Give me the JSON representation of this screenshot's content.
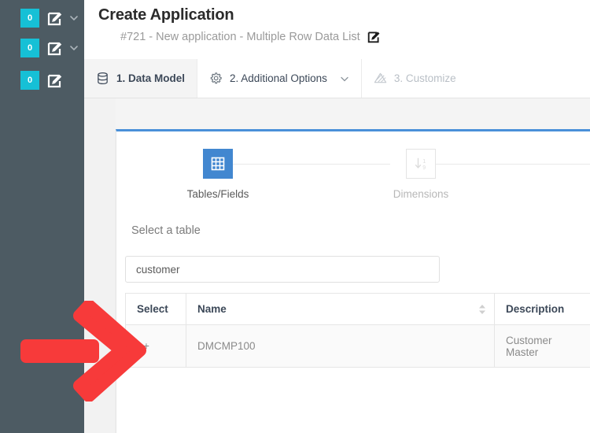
{
  "colors": {
    "sidebar_bg": "#4d5b63",
    "badge_bg": "#16c0d6",
    "accent_blue": "#4a90d9",
    "step_active": "#4287d0",
    "annotation_red": "#f73a3a",
    "panel_bg": "#ffffff",
    "page_bg": "#f2f2f2"
  },
  "sidebar": {
    "rows": [
      {
        "badge": "0",
        "edit_icon": "edit-square-icon",
        "chevron_icon": "chevron-down-icon",
        "has_chevron": true
      },
      {
        "badge": "0",
        "edit_icon": "edit-square-icon",
        "chevron_icon": "chevron-down-icon",
        "has_chevron": true
      },
      {
        "badge": "0",
        "edit_icon": "edit-square-icon",
        "chevron_icon": "",
        "has_chevron": false
      }
    ]
  },
  "header": {
    "title": "Create Application",
    "subtitle": "#721 - New application - Multiple Row Data List",
    "subtitle_edit_icon": "edit-square-icon"
  },
  "tabs": [
    {
      "label": "1. Data Model",
      "icon": "database-icon",
      "state": "active",
      "has_chevron": false
    },
    {
      "label": "2. Additional Options",
      "icon": "gear-icon",
      "state": "enabled",
      "has_chevron": true
    },
    {
      "label": "3. Customize",
      "icon": "layers-icon",
      "state": "disabled",
      "has_chevron": false
    }
  ],
  "steps": [
    {
      "label": "Tables/Fields",
      "icon": "table-grid-icon",
      "state": "active"
    },
    {
      "label": "Dimensions",
      "icon": "sort-numeric-icon",
      "state": "inactive"
    }
  ],
  "form": {
    "select_table_label": "Select a table",
    "search_value": "customer",
    "search_placeholder": "Select a table"
  },
  "table": {
    "columns": [
      {
        "label": "Select",
        "sortable": false
      },
      {
        "label": "Name",
        "sortable": true,
        "sort_icon": "sort-updown-icon"
      },
      {
        "label": "Description",
        "sortable": false
      }
    ],
    "rows": [
      {
        "select": "+",
        "name": "DMCMP100",
        "description": "Customer Master"
      }
    ]
  },
  "annotation": {
    "arrow_icon": "arrow-right-annotation",
    "direction": "right"
  }
}
